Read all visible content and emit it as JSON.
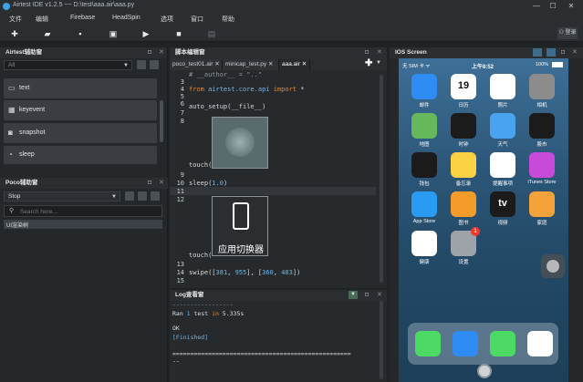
{
  "window": {
    "title": "Airtest IDE v1.2.5  ~~  D:\\test\\aaa.air\\aaa.py",
    "minimize": "—",
    "maximize": "☐",
    "close": "✕"
  },
  "menu": [
    "文件",
    "编辑",
    "Firebase",
    "HeadSpin",
    "选项",
    "窗口",
    "帮助"
  ],
  "toolbar": {
    "user_label": "登录"
  },
  "airtest_panel": {
    "title": "Airtest辅助窗",
    "filter_value": "All",
    "buttons": [
      "text",
      "keyevent",
      "snapshot",
      "sleep"
    ]
  },
  "poco_panel": {
    "title": "Poco辅助窗",
    "mode_value": "Stop",
    "search_placeholder": "Search here...",
    "tree_item": "UI渲染树"
  },
  "editor": {
    "title": "脚本编辑窗",
    "tabs": [
      "poco_test01.air",
      "minicap_test.py",
      "aaa.air"
    ],
    "partial_line": "# __author__ = \"..\"",
    "lines": {
      "n3": "3",
      "n4": "4",
      "n5": "5",
      "n6": "6",
      "n7": "7",
      "n8": "8",
      "n9": "9",
      "n10": "10",
      "n11": "11",
      "n12": "12",
      "n13": "13",
      "n14": "14",
      "n15": "15",
      "l3_from": "from",
      "l3_mod": " airtest.core.api ",
      "l3_import": "import",
      "l3_star": " *",
      "l5": "auto_setup(__file__)",
      "l9": "touch(",
      "l10_fn": "sleep(",
      "l10_num": "1.0",
      "l10_end": ")",
      "l13": "touch(",
      "l14_fn": "swipe([",
      "l14_a": "381",
      "l14_b": ", ",
      "l14_c": "955",
      "l14_d": "], [",
      "l14_e": "360",
      "l14_f": ", ",
      "l14_g": "483",
      "l14_h": "])"
    },
    "image_caption": "应用切换器"
  },
  "log": {
    "title": "Log查看窗",
    "divider_top": "-----------------",
    "ran_prefix": "Ran ",
    "ran_num": "1",
    "ran_mid": " test ",
    "ran_in": "in",
    "ran_time": " 5.335s",
    "ok": "OK",
    "finished": "[Finished]",
    "divider": "==================================================",
    "dashes": "--"
  },
  "ios": {
    "title": "IOS Screen",
    "status": {
      "carrier": "无 SIM 卡 ᯤ",
      "time": "上午8:52",
      "battery": "100%"
    },
    "apps": [
      {
        "label": "邮件",
        "color": "#2f8cf4"
      },
      {
        "label": "日历",
        "color": "#ffffff",
        "text": "19"
      },
      {
        "label": "照片",
        "color": "#ffffff"
      },
      {
        "label": "相机",
        "color": "#8c8c8c"
      },
      {
        "label": "地图",
        "color": "#66b85a"
      },
      {
        "label": "时钟",
        "color": "#1b1b1b"
      },
      {
        "label": "天气",
        "color": "#4aa3ef"
      },
      {
        "label": "股市",
        "color": "#1b1b1b"
      },
      {
        "label": "钱包",
        "color": "#1b1b1b"
      },
      {
        "label": "备忘录",
        "color": "#fbd244"
      },
      {
        "label": "提醒事项",
        "color": "#ffffff"
      },
      {
        "label": "iTunes Store",
        "color": "#c74ad9"
      },
      {
        "label": "App Store",
        "color": "#2a9bf3"
      },
      {
        "label": "图书",
        "color": "#f59b29"
      },
      {
        "label": "视频",
        "color": "#1b1b1b",
        "text": "tv"
      },
      {
        "label": "家庭",
        "color": "#f3a33a"
      },
      {
        "label": "健康",
        "color": "#ffffff"
      },
      {
        "label": "设置",
        "color": "#9da3a8",
        "badge": "1"
      }
    ],
    "dock": [
      {
        "color": "#4cd964"
      },
      {
        "color": "#2f8cf4"
      },
      {
        "color": "#4cd964"
      },
      {
        "color": "#ffffff"
      }
    ]
  }
}
